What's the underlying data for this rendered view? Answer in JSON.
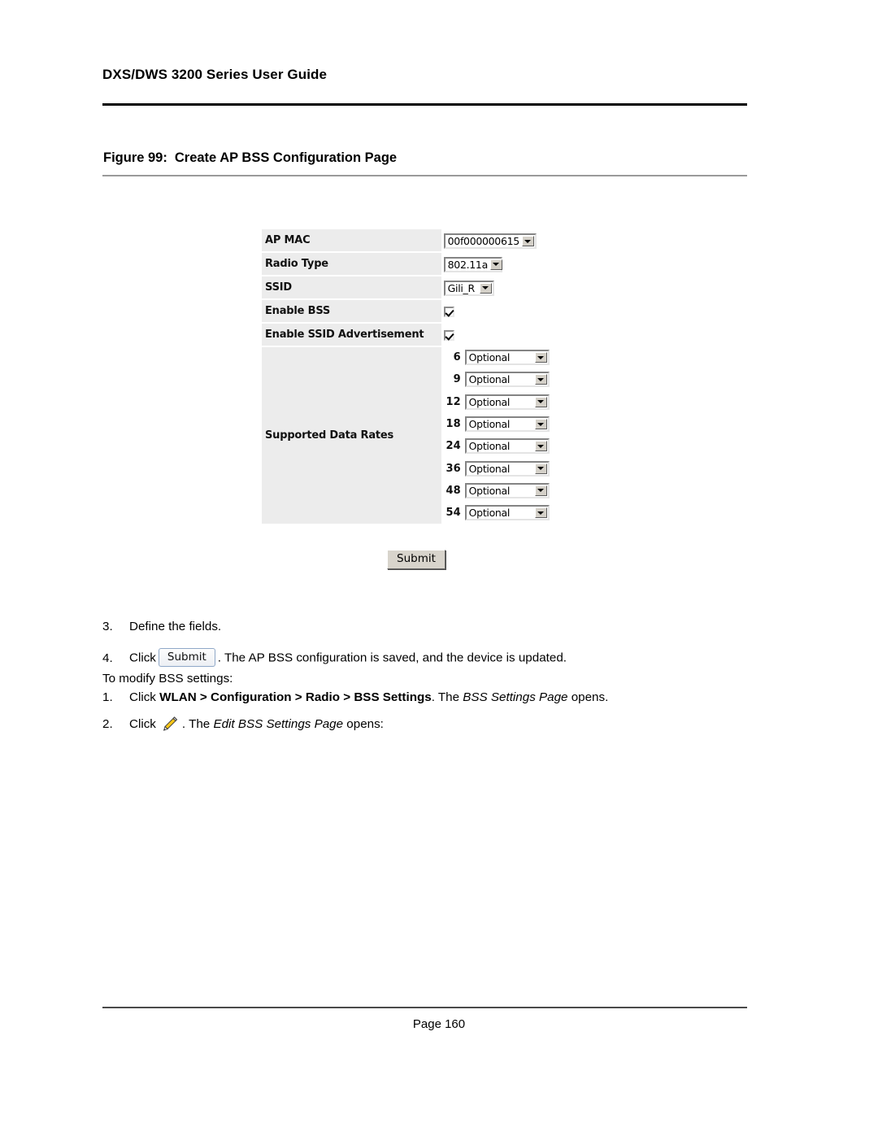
{
  "document": {
    "header_title": "DXS/DWS 3200 Series User Guide",
    "footer_page": "Page 160"
  },
  "figure": {
    "number": "Figure 99:",
    "title": "Create AP BSS Configuration Page"
  },
  "form": {
    "rows": [
      {
        "label": "AP MAC",
        "control": "select",
        "value": "00f000000615"
      },
      {
        "label": "Radio Type",
        "control": "select",
        "value": "802.11a"
      },
      {
        "label": "SSID",
        "control": "select",
        "value": "Gili_R"
      },
      {
        "label": "Enable BSS",
        "control": "checkbox",
        "checked": true
      },
      {
        "label": "Enable SSID Advertisement",
        "control": "checkbox",
        "checked": true
      }
    ],
    "rates_label": "Supported Data Rates",
    "rates": [
      {
        "rate": "6",
        "value": "Optional"
      },
      {
        "rate": "9",
        "value": "Optional"
      },
      {
        "rate": "12",
        "value": "Optional"
      },
      {
        "rate": "18",
        "value": "Optional"
      },
      {
        "rate": "24",
        "value": "Optional"
      },
      {
        "rate": "36",
        "value": "Optional"
      },
      {
        "rate": "48",
        "value": "Optional"
      },
      {
        "rate": "54",
        "value": "Optional"
      }
    ],
    "submit_label": "Submit"
  },
  "instructions": {
    "step3_num": "3.",
    "step3_text": "Define the fields.",
    "step4_num": "4.",
    "step4_click": "Click",
    "step4_button": "Submit",
    "step4_rest": ". The AP BSS configuration is saved, and the device is updated.",
    "intro_modify": "To modify BSS settings:",
    "m1_num": "1.",
    "m1_click": "Click",
    "m1_nav": "WLAN > Configuration > Radio > BSS Settings",
    "m1_mid": ".  The",
    "m1_italic": "BSS Settings Page",
    "m1_end": "opens.",
    "m2_num": "2.",
    "m2_click": "Click",
    "m2_mid": ". The",
    "m2_italic": "Edit BSS Settings Page",
    "m2_end": "opens:"
  },
  "colors": {
    "label_bg": "#ececec",
    "rule_dark": "#000000",
    "rule_light": "#9a9a9a",
    "button_face": "#d8d4cc",
    "pencil_yellow": "#f5c518"
  }
}
